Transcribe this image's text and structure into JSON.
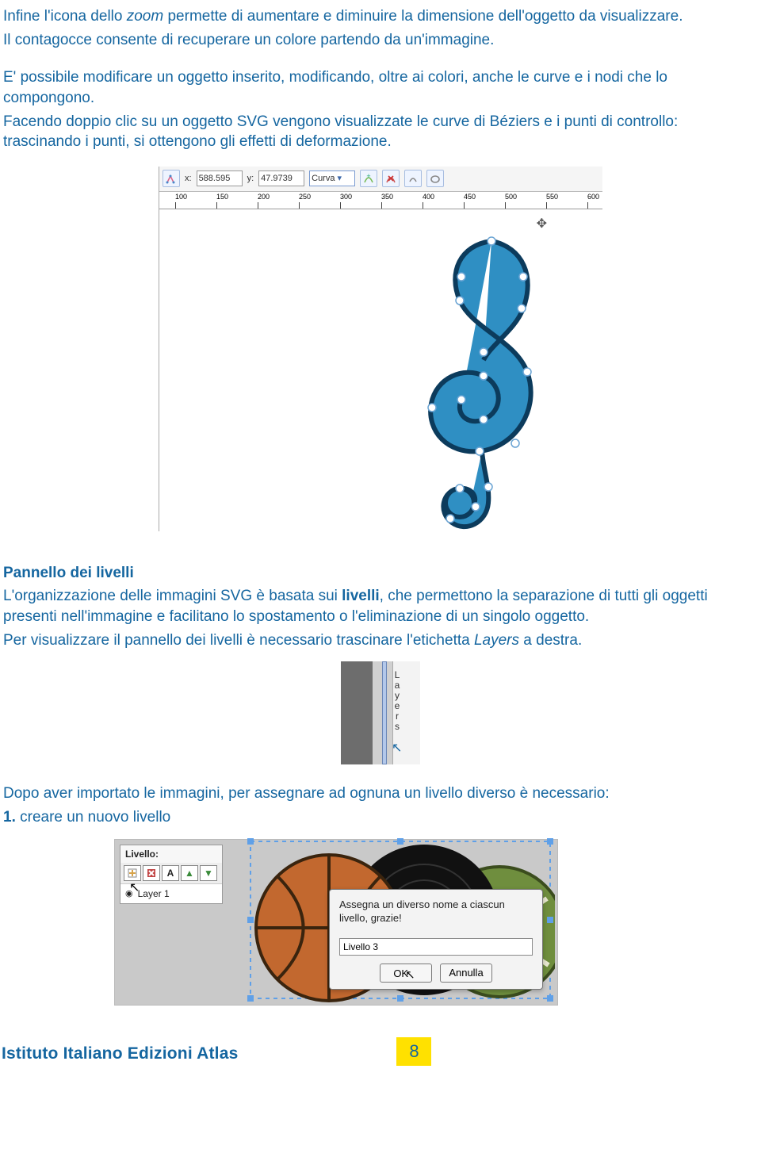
{
  "para1a": "Infine l'icona dello ",
  "para1b": "zoom",
  "para1c": " permette di aumentare e diminuire la dimensione dell'oggetto da visualizzare.",
  "para2": "Il contagocce consente di recuperare un colore partendo da un'immagine.",
  "para3": "E' possibile modificare un oggetto inserito, modificando, oltre ai colori, anche le curve e i nodi che lo compongono.",
  "para4": "Facendo doppio clic su un oggetto SVG vengono visualizzate le curve di Béziers e i punti di controllo: trascinando i punti, si ottengono gli effetti di deformazione.",
  "shot1": {
    "x_label": "x:",
    "x_value": "588.595",
    "y_label": "y:",
    "y_value": "47.9739",
    "select_value": "Curva",
    "ruler_ticks": [
      "100",
      "150",
      "200",
      "250",
      "300",
      "350",
      "400",
      "450",
      "500",
      "550",
      "600"
    ]
  },
  "heading2": "Pannello dei livelli",
  "para5a": "L'organizzazione delle immagini SVG è basata sui ",
  "para5b": "livelli",
  "para5c": ", che permettono la separazione di tutti gli oggetti presenti nell'immagine e facilitano lo spostamento o l'eliminazione di un singolo oggetto.",
  "para6a": "Per visualizzare il pannello dei livelli è necessario trascinare l'etichetta ",
  "para6b": "Layers",
  "para6c": " a destra.",
  "shot2": {
    "label": "Layers"
  },
  "para7": "Dopo aver importato le immagini, per assegnare ad ognuna un livello diverso è necessario:",
  "step1_num": "1.",
  "step1_text": " creare un nuovo livello",
  "shot3": {
    "panel_header": "Livello:",
    "layer_entry": "Layer 1",
    "dlg_msg": "Assegna un diverso nome a ciascun livello, grazie!",
    "dlg_input": "Livello 3",
    "btn_ok": "OK",
    "btn_cancel": "Annulla"
  },
  "footer_brand": "Istituto Italiano Edizioni Atlas",
  "footer_page": "8"
}
